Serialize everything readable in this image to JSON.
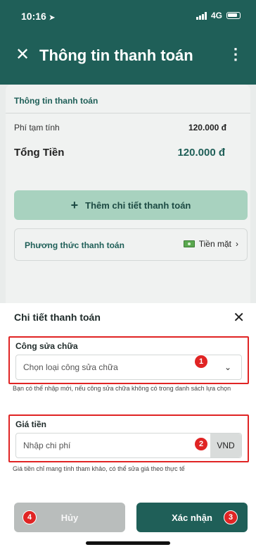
{
  "status_bar": {
    "time": "10:16",
    "network": "4G"
  },
  "header": {
    "title": "Thông tin thanh toán"
  },
  "summary": {
    "section_title": "Thông tin thanh toán",
    "provisional_fee_label": "Phí tạm tính",
    "provisional_fee_value": "120.000 đ",
    "total_label": "Tổng Tiền",
    "total_value": "120.000 đ",
    "add_detail_label": "Thêm chi tiết thanh toán",
    "payment_method_label": "Phương thức thanh toán",
    "payment_method_value": "Tiền mặt"
  },
  "sheet": {
    "title": "Chi tiết thanh toán",
    "repair_field": {
      "label": "Công sửa chữa",
      "placeholder": "Chọn loại công sửa chữa",
      "help": "Bạn có thể nhập mới, nếu công sửa chữa không có trong danh sách lựa chọn",
      "badge": "1"
    },
    "price_field": {
      "label": "Giá tiền",
      "placeholder": "Nhập chi phí",
      "unit": "VND",
      "help": "Giá tiền chỉ mang tính tham khảo, có thể sửa giá theo thực tế",
      "badge": "2"
    },
    "cancel_label": "Hủy",
    "cancel_badge": "4",
    "confirm_label": "Xác nhận",
    "confirm_badge": "3"
  },
  "icons": {
    "close": "close-icon",
    "more": "more-vertical-icon",
    "location": "location-arrow-icon",
    "signal": "signal-icon",
    "battery": "battery-icon",
    "plus": "plus-icon",
    "cash": "cash-icon",
    "chevron_right": "chevron-right-icon",
    "chevron_down": "chevron-down-icon"
  },
  "colors": {
    "brand": "#1f5f58",
    "accent_light": "#a8d2bf",
    "highlight": "#e02424",
    "disabled": "#b9bdbc"
  }
}
